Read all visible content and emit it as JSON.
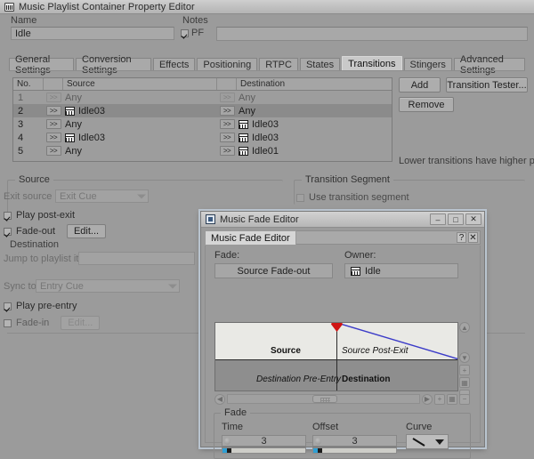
{
  "main_window": {
    "title": "Music Playlist Container Property Editor",
    "icon": "music-segment-icon",
    "name_label": "Name",
    "name_value": "Idle",
    "notes_label": "Notes",
    "notes_value": "",
    "pf_label": "PF",
    "pf_checked": true,
    "tabs": [
      {
        "label": "General Settings",
        "selected": false
      },
      {
        "label": "Conversion Settings",
        "selected": false
      },
      {
        "label": "Effects",
        "selected": false
      },
      {
        "label": "Positioning",
        "selected": false
      },
      {
        "label": "RTPC",
        "selected": false
      },
      {
        "label": "States",
        "selected": false
      },
      {
        "label": "Transitions",
        "selected": true
      },
      {
        "label": "Stingers",
        "selected": false
      },
      {
        "label": "Advanced Settings",
        "selected": false
      }
    ]
  },
  "transitions_table": {
    "headers": {
      "no": "No.",
      "arrow1": "",
      "source": "Source",
      "arrow2": "",
      "destination": "Destination"
    },
    "arrow_glyph": ">>",
    "rows": [
      {
        "no": "1",
        "src_btn_enabled": false,
        "src_icon": false,
        "source": "Any",
        "dst_btn_enabled": false,
        "dst_icon": false,
        "destination": "Any",
        "selected": false,
        "dim": true
      },
      {
        "no": "2",
        "src_btn_enabled": true,
        "src_icon": true,
        "source": "Idle03",
        "dst_btn_enabled": true,
        "dst_icon": false,
        "destination": "Any",
        "selected": true,
        "dim": false
      },
      {
        "no": "3",
        "src_btn_enabled": true,
        "src_icon": false,
        "source": "Any",
        "dst_btn_enabled": true,
        "dst_icon": true,
        "destination": "Idle03",
        "selected": false,
        "dim": false
      },
      {
        "no": "4",
        "src_btn_enabled": true,
        "src_icon": true,
        "source": "Idle03",
        "dst_btn_enabled": true,
        "dst_icon": true,
        "destination": "Idle03",
        "selected": false,
        "dim": false
      },
      {
        "no": "5",
        "src_btn_enabled": true,
        "src_icon": false,
        "source": "Any",
        "dst_btn_enabled": true,
        "dst_icon": true,
        "destination": "Idle01",
        "selected": false,
        "dim": false
      }
    ]
  },
  "side_buttons": {
    "add": "Add",
    "transition_tester": "Transition Tester...",
    "remove": "Remove",
    "priority_note": "Lower transitions have higher priority."
  },
  "source_group": {
    "caption": "Source",
    "exit_source_at_label": "Exit source at",
    "exit_source_at_value": "Exit Cue",
    "play_post_exit_label": "Play post-exit",
    "play_post_exit_checked": true,
    "fade_out_label": "Fade-out",
    "fade_out_checked": true,
    "fade_out_edit": "Edit..."
  },
  "transition_segment_group": {
    "caption": "Transition Segment",
    "use_label": "Use transition segment",
    "use_checked": false
  },
  "destination_group": {
    "caption": "Destination",
    "jump_label": "Jump to playlist item",
    "jump_value": "",
    "sync_label": "Sync to",
    "sync_value": "Entry Cue",
    "play_pre_entry_label": "Play pre-entry",
    "play_pre_entry_checked": true,
    "fade_in_label": "Fade-in",
    "fade_in_checked": false,
    "fade_in_edit": "Edit..."
  },
  "fade_dialog": {
    "title": "Music Fade Editor",
    "tab_label": "Music Fade Editor",
    "window_buttons": {
      "minimize": "–",
      "maximize": "□",
      "close": "✕"
    },
    "tab_help": "?",
    "tab_close": "✕",
    "fade_label": "Fade:",
    "fade_value": "Source Fade-out",
    "owner_label": "Owner:",
    "owner_value": "Idle",
    "owner_icon": "music-segment-icon",
    "graph": {
      "source_label": "Source",
      "source_post_exit_label": "Source Post-Exit",
      "destination_pre_entry_label": "Destination Pre-Entry",
      "destination_label": "Destination",
      "curve_color": "#3b3bc8",
      "marker_color": "#cf1414"
    },
    "fade_group": {
      "caption": "Fade",
      "time_label": "Time",
      "time_value": "3",
      "offset_label": "Offset",
      "offset_value": "3",
      "curve_label": "Curve",
      "curve_icon": "linear-down-curve-icon"
    }
  },
  "colors": {
    "window_bg": "#9b9b9b",
    "field_bg": "#a8a8a8",
    "accent_slider": "#2f9fd4",
    "selection": "#8b8b8b"
  }
}
